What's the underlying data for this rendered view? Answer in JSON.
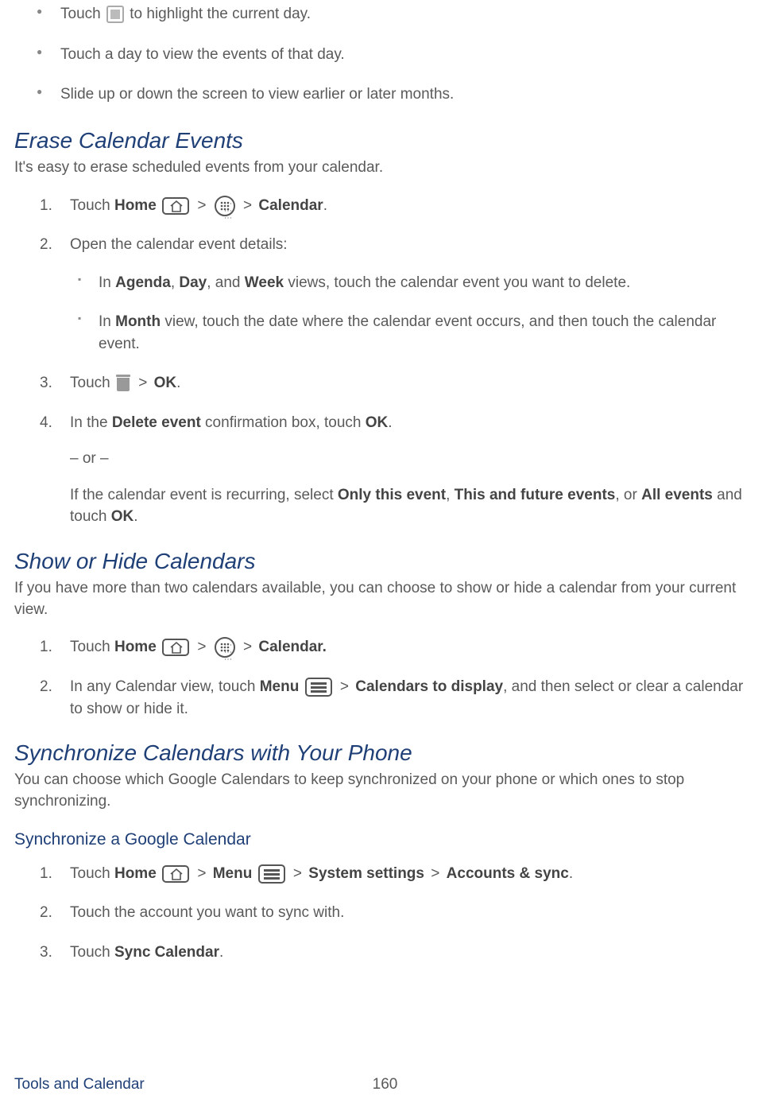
{
  "top_bullets": [
    {
      "pre": "Touch ",
      "icon": "today",
      "post": " to highlight the current day."
    },
    {
      "text": "Touch a day to view the events of that day."
    },
    {
      "text": "Slide up or down the screen to view earlier or later months."
    }
  ],
  "erase": {
    "heading": "Erase Calendar Events",
    "intro": "It's easy to erase scheduled events from your calendar.",
    "steps": {
      "s1": {
        "pre": "Touch ",
        "bold1": "Home",
        "mid1": " > ",
        "mid2": " > ",
        "bold2": "Calendar",
        "post": "."
      },
      "s2": "Open the calendar event details:",
      "s2_sub": [
        {
          "pre": "In ",
          "b1": "Agenda",
          "sep": ", ",
          "b2": "Day",
          "mid": ", and ",
          "b3": "Week",
          "post": " views, touch the calendar event you want to delete."
        },
        {
          "pre": "In ",
          "b1": "Month",
          "post": " view, touch the date where the calendar event occurs, and then touch the calendar event."
        }
      ],
      "s3": {
        "pre": "Touch ",
        "mid": " > ",
        "bold": "OK",
        "post": "."
      },
      "s4": {
        "pre": "In the ",
        "b1": "Delete event",
        "mid": " confirmation box, touch ",
        "b2": "OK",
        "post": "."
      },
      "s4_or": "– or –",
      "s4_extra": {
        "pre": "If the calendar event is recurring, select ",
        "b1": "Only this event",
        "sep1": ", ",
        "b2": "This and future events",
        "sep2": ", or ",
        "b3": "All events",
        "mid": " and touch ",
        "b4": "OK",
        "post": "."
      }
    }
  },
  "showhide": {
    "heading": "Show or Hide Calendars",
    "intro": "If you have more than two calendars available, you can choose to show or hide a calendar from your current view.",
    "steps": {
      "s1": {
        "pre": "Touch ",
        "bold1": "Home",
        "mid1": " > ",
        "mid2": " > ",
        "bold2": "Calendar.",
        "post": ""
      },
      "s2": {
        "pre": "In any Calendar view, touch ",
        "b1": "Menu",
        "mid": " > ",
        "b2": "Calendars to display",
        "post": ", and then select or clear a calendar to show or hide it."
      }
    }
  },
  "sync": {
    "heading": "Synchronize Calendars with Your Phone",
    "intro": "You can choose which Google Calendars to keep synchronized on your phone or which ones to stop synchronizing.",
    "sub_heading": "Synchronize a Google Calendar",
    "steps": {
      "s1": {
        "pre": "Touch ",
        "b1": "Home",
        "mid1": " > ",
        "b2": "Menu",
        "mid2": " > ",
        "b3": "System settings",
        "mid3": " > ",
        "b4": "Accounts & sync",
        "post": "."
      },
      "s2": "Touch the account you want to sync with.",
      "s3": {
        "pre": "Touch ",
        "b1": "Sync Calendar",
        "post": "."
      }
    }
  },
  "footer": {
    "section": "Tools and Calendar",
    "page": "160"
  }
}
